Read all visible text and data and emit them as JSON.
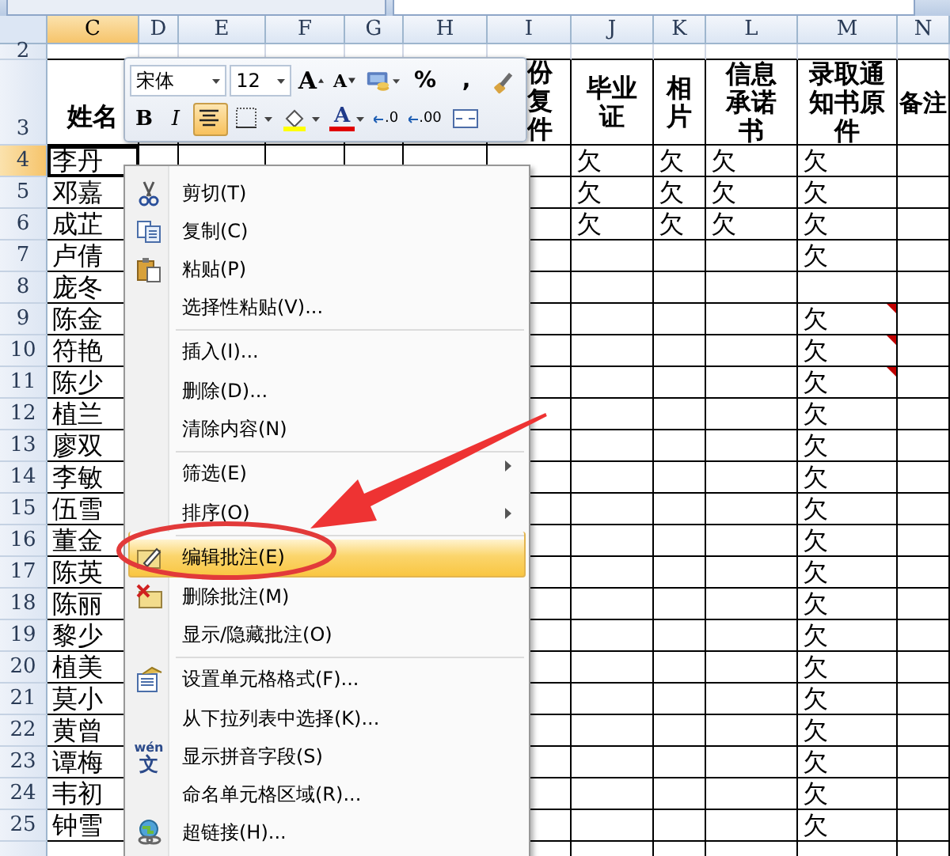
{
  "columns": [
    {
      "label": "C",
      "selected": true
    },
    {
      "label": "D",
      "selected": false
    },
    {
      "label": "E",
      "selected": false
    },
    {
      "label": "F",
      "selected": false
    },
    {
      "label": "G",
      "selected": false
    },
    {
      "label": "H",
      "selected": false
    },
    {
      "label": "I",
      "selected": false
    },
    {
      "label": "J",
      "selected": false
    },
    {
      "label": "K",
      "selected": false
    },
    {
      "label": "L",
      "selected": false
    },
    {
      "label": "M",
      "selected": false
    },
    {
      "label": "N",
      "selected": false
    }
  ],
  "row2": {
    "n": "2"
  },
  "header_row": {
    "n": "3",
    "C": "姓名",
    "I": "份复件",
    "J": "毕业证",
    "K": "相片",
    "L": "信息承诺书",
    "M": "录取通知书原件",
    "N": "备注"
  },
  "rows": [
    {
      "n": "4",
      "selected": true,
      "C": "李丹",
      "J": "欠",
      "K": "欠",
      "L": "欠",
      "M": "欠",
      "comment": false
    },
    {
      "n": "5",
      "selected": false,
      "C": "邓嘉",
      "J": "欠",
      "K": "欠",
      "L": "欠",
      "M": "欠",
      "comment": false
    },
    {
      "n": "6",
      "selected": false,
      "C": "成芷",
      "J": "欠",
      "K": "欠",
      "L": "欠",
      "M": "欠",
      "comment": false
    },
    {
      "n": "7",
      "selected": false,
      "C": "卢倩",
      "M": "欠",
      "comment": false
    },
    {
      "n": "8",
      "selected": false,
      "C": "庞冬",
      "comment": false
    },
    {
      "n": "9",
      "selected": false,
      "C": "陈金",
      "M": "欠",
      "comment": true
    },
    {
      "n": "10",
      "selected": false,
      "C": "符艳",
      "M": "欠",
      "comment": true
    },
    {
      "n": "11",
      "selected": false,
      "C": "陈少",
      "M": "欠",
      "comment": true
    },
    {
      "n": "12",
      "selected": false,
      "C": "植兰",
      "M": "欠",
      "comment": false
    },
    {
      "n": "13",
      "selected": false,
      "C": "廖双",
      "M": "欠",
      "comment": false
    },
    {
      "n": "14",
      "selected": false,
      "C": "李敏",
      "M": "欠",
      "comment": false
    },
    {
      "n": "15",
      "selected": false,
      "C": "伍雪",
      "M": "欠",
      "comment": false
    },
    {
      "n": "16",
      "selected": false,
      "C": "董金",
      "M": "欠",
      "comment": false
    },
    {
      "n": "17",
      "selected": false,
      "C": "陈英",
      "M": "欠",
      "comment": false
    },
    {
      "n": "18",
      "selected": false,
      "C": "陈丽",
      "M": "欠",
      "comment": false
    },
    {
      "n": "19",
      "selected": false,
      "C": "黎少",
      "M": "欠",
      "comment": false
    },
    {
      "n": "20",
      "selected": false,
      "C": "植美",
      "M": "欠",
      "comment": false
    },
    {
      "n": "21",
      "selected": false,
      "C": "莫小",
      "M": "欠",
      "comment": false
    },
    {
      "n": "22",
      "selected": false,
      "C": "黄曾",
      "M": "欠",
      "comment": false
    },
    {
      "n": "23",
      "selected": false,
      "C": "谭梅",
      "M": "欠",
      "comment": false
    },
    {
      "n": "24",
      "selected": false,
      "C": "韦初",
      "M": "欠",
      "comment": false
    },
    {
      "n": "25",
      "selected": false,
      "C": "钟雪",
      "M": "欠",
      "comment": false
    }
  ],
  "mini_toolbar": {
    "font": "宋体",
    "size": "12",
    "row1": [
      {
        "kind": "grow",
        "text": "A"
      },
      {
        "kind": "shrink",
        "text": "A"
      },
      {
        "kind": "accounting"
      },
      {
        "kind": "text",
        "text": "%"
      },
      {
        "kind": "text",
        "text": ","
      },
      {
        "kind": "painter"
      }
    ],
    "row2": [
      {
        "kind": "bold",
        "text": "B"
      },
      {
        "kind": "italic",
        "text": "I"
      },
      {
        "kind": "center",
        "selected": true
      },
      {
        "kind": "borders"
      },
      {
        "kind": "fill"
      },
      {
        "kind": "fontcolor",
        "text": "A"
      },
      {
        "kind": "decimal_more",
        "text": ".0"
      },
      {
        "kind": "decimal_less",
        "text": ".00"
      },
      {
        "kind": "merge"
      }
    ]
  },
  "context_menu": [
    {
      "label": "剪切(T)",
      "kind": "cut",
      "separator_before": false,
      "submenu": false,
      "selected": false
    },
    {
      "label": "复制(C)",
      "kind": "copy",
      "separator_before": false,
      "submenu": false,
      "selected": false
    },
    {
      "label": "粘贴(P)",
      "kind": "paste",
      "separator_before": false,
      "submenu": false,
      "selected": false
    },
    {
      "label": "选择性粘贴(V)...",
      "kind": "plain",
      "separator_before": false,
      "submenu": false,
      "selected": false
    },
    {
      "label": "插入(I)...",
      "kind": "plain",
      "separator_before": true,
      "submenu": false,
      "selected": false
    },
    {
      "label": "删除(D)...",
      "kind": "plain",
      "separator_before": false,
      "submenu": false,
      "selected": false
    },
    {
      "label": "清除内容(N)",
      "kind": "plain",
      "separator_before": false,
      "submenu": false,
      "selected": false
    },
    {
      "label": "筛选(E)",
      "kind": "plain",
      "separator_before": true,
      "submenu": true,
      "selected": false
    },
    {
      "label": "排序(O)",
      "kind": "plain",
      "separator_before": false,
      "submenu": true,
      "selected": false
    },
    {
      "label": "编辑批注(E)",
      "kind": "edit_comment",
      "separator_before": true,
      "submenu": false,
      "selected": true
    },
    {
      "label": "删除批注(M)",
      "kind": "delete_comment",
      "separator_before": false,
      "submenu": false,
      "selected": false
    },
    {
      "label": "显示/隐藏批注(O)",
      "kind": "plain",
      "separator_before": false,
      "submenu": false,
      "selected": false
    },
    {
      "label": "设置单元格格式(F)...",
      "kind": "format",
      "separator_before": true,
      "submenu": false,
      "selected": false
    },
    {
      "label": "从下拉列表中选择(K)...",
      "kind": "plain",
      "separator_before": false,
      "submenu": false,
      "selected": false
    },
    {
      "label": "显示拼音字段(S)",
      "kind": "phonetic",
      "icon_text": [
        "wén",
        "文"
      ],
      "separator_before": false,
      "submenu": false,
      "selected": false
    },
    {
      "label": "命名单元格区域(R)...",
      "kind": "plain",
      "separator_before": false,
      "submenu": false,
      "selected": false
    },
    {
      "label": "超链接(H)...",
      "kind": "link",
      "separator_before": false,
      "submenu": false,
      "selected": false
    }
  ]
}
